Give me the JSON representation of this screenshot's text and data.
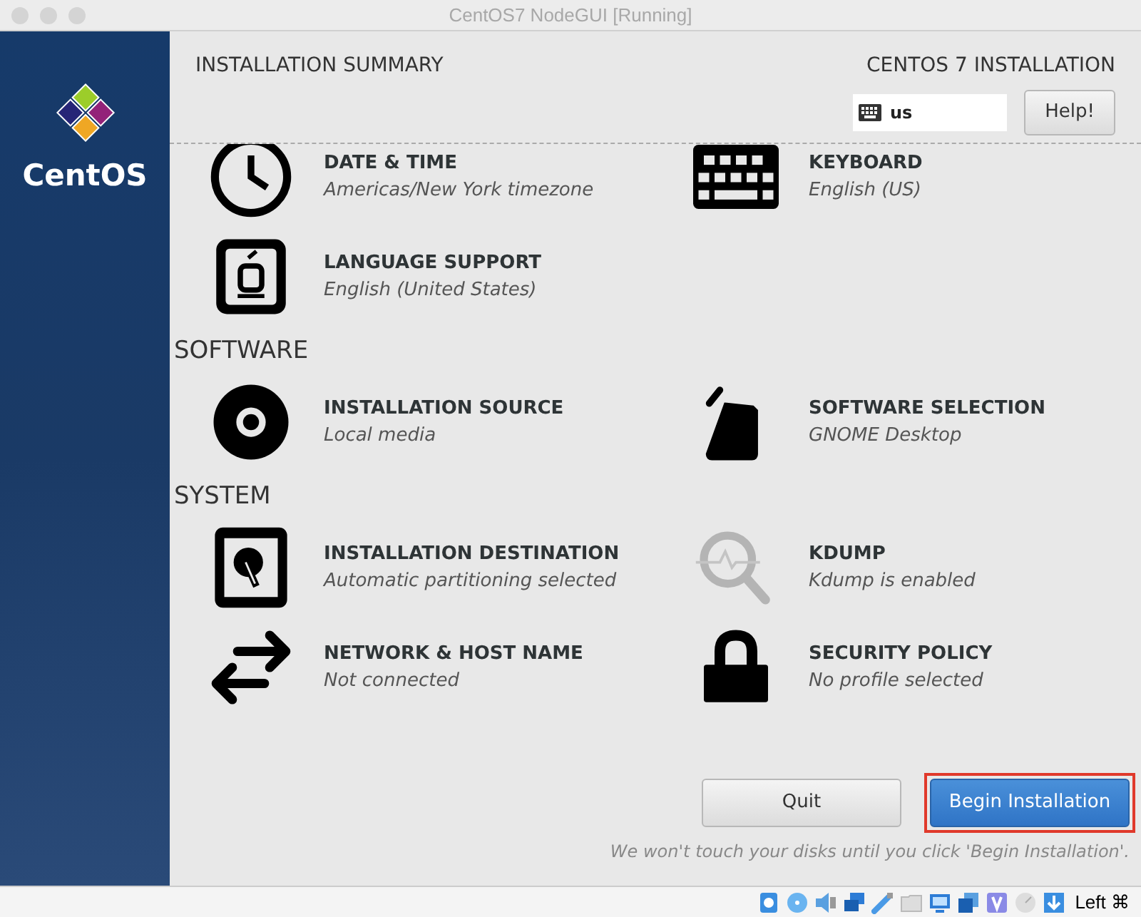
{
  "window": {
    "title": "CentOS7 NodeGUI [Running]"
  },
  "sidebar": {
    "logo_text": "CentOS"
  },
  "header": {
    "title": "INSTALLATION SUMMARY",
    "product": "CENTOS 7 INSTALLATION",
    "keyboard_layout": "us",
    "help_button": "Help!"
  },
  "sections": [
    {
      "spokes": [
        {
          "title": "DATE & TIME",
          "status": "Americas/New York timezone"
        },
        {
          "title": "KEYBOARD",
          "status": "English (US)"
        },
        {
          "title": "LANGUAGE SUPPORT",
          "status": "English (United States)"
        }
      ]
    },
    {
      "heading": "SOFTWARE",
      "spokes": [
        {
          "title": "INSTALLATION SOURCE",
          "status": "Local media"
        },
        {
          "title": "SOFTWARE SELECTION",
          "status": "GNOME Desktop"
        }
      ]
    },
    {
      "heading": "SYSTEM",
      "spokes": [
        {
          "title": "INSTALLATION DESTINATION",
          "status": "Automatic partitioning selected"
        },
        {
          "title": "KDUMP",
          "status": "Kdump is enabled"
        },
        {
          "title": "NETWORK & HOST NAME",
          "status": "Not connected"
        },
        {
          "title": "SECURITY POLICY",
          "status": "No profile selected"
        }
      ]
    }
  ],
  "buttons": [
    {
      "label": "Quit",
      "kind": "secondary",
      "highlighted": false
    },
    {
      "label": "Begin Installation",
      "kind": "primary",
      "highlighted": true
    }
  ],
  "footer_note": "We won't touch your disks until you click 'Begin Installation'.",
  "status_bar": {
    "host_key": "Left ⌘"
  }
}
